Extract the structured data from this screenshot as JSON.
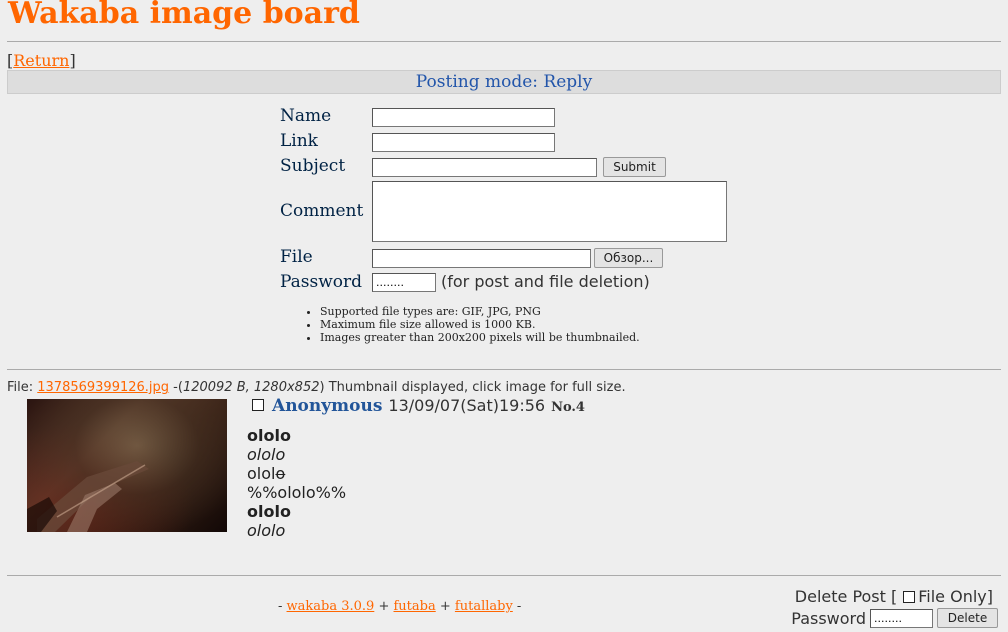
{
  "header": {
    "title": "Wakaba image board"
  },
  "nav": {
    "return_label": "Return",
    "open_bracket": "[",
    "close_bracket": "]"
  },
  "posting_mode": "Posting mode: Reply",
  "form": {
    "name_label": "Name",
    "link_label": "Link",
    "subject_label": "Subject",
    "comment_label": "Comment",
    "file_label": "File",
    "password_label": "Password",
    "submit_label": "Submit",
    "browse_label": "Обзор...",
    "password_value": "........",
    "password_note": "(for post and file deletion)",
    "rules": [
      "Supported file types are: GIF, JPG, PNG",
      "Maximum file size allowed is 1000 KB.",
      "Images greater than 200x200 pixels will be thumbnailed."
    ]
  },
  "post": {
    "file_prefix": "File: ",
    "file_name": "1378569399126.jpg",
    "file_meta": "120092 B, 1280x852",
    "file_note": " Thumbnail displayed, click image for full size.",
    "poster": "Anonymous",
    "date": "13/09/07(Sat)19:56",
    "number": "No.4",
    "lines": [
      {
        "text": "ololo",
        "style": "bold"
      },
      {
        "text": "ololo",
        "style": "italic"
      },
      {
        "text": "ololo",
        "style": "strike-last"
      },
      {
        "text": "%%ololo%%",
        "style": "normal"
      },
      {
        "text": "ololo",
        "style": "bold"
      },
      {
        "text": "ololo",
        "style": "italic"
      }
    ]
  },
  "footer": {
    "links": [
      "wakaba 3.0.9",
      "futaba",
      "futallaby"
    ],
    "delete_post_label": "Delete Post [",
    "file_only_label": "File Only]",
    "password_label": "Password",
    "password_value": "........",
    "delete_button": "Delete"
  },
  "colors": {
    "accent": "#ff6600",
    "poster": "#225599",
    "label": "#002244",
    "background": "#eeeeee"
  }
}
